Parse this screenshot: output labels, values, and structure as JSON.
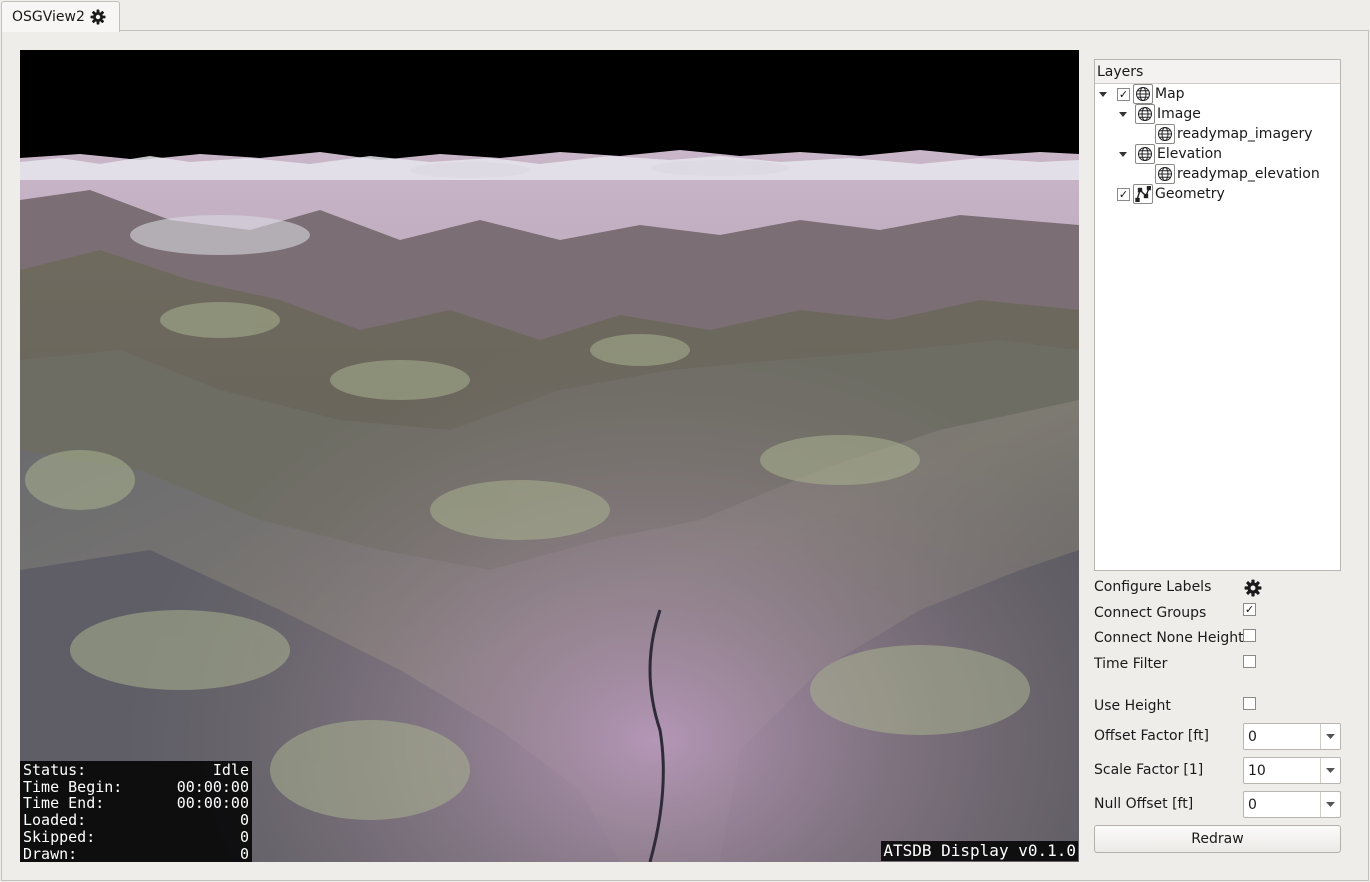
{
  "tab": {
    "title": "OSGView2",
    "icon": "gear-icon"
  },
  "viewport": {
    "status": [
      {
        "label": "Status:",
        "value": "Idle"
      },
      {
        "label": "Time Begin:",
        "value": "00:00:00"
      },
      {
        "label": "Time End:",
        "value": "00:00:00"
      },
      {
        "label": "Loaded:",
        "value": "0"
      },
      {
        "label": "Skipped:",
        "value": "0"
      },
      {
        "label": "Drawn:",
        "value": "0"
      }
    ],
    "version": "ATSDB Display v0.1.0"
  },
  "layers": {
    "header": "Layers",
    "items": [
      {
        "label": "Map",
        "checked": true,
        "expanded": true,
        "icon": "globe-icon"
      },
      {
        "label": "Image",
        "expanded": true,
        "icon": "globe-icon"
      },
      {
        "label": "readymap_imagery",
        "icon": "globe-icon"
      },
      {
        "label": "Elevation",
        "expanded": true,
        "icon": "globe-icon"
      },
      {
        "label": "readymap_elevation",
        "icon": "globe-icon"
      },
      {
        "label": "Geometry",
        "checked": true,
        "icon": "geometry-icon"
      }
    ]
  },
  "controls": {
    "configure_labels": "Configure Labels",
    "connect_groups": {
      "label": "Connect Groups",
      "checked": true
    },
    "connect_none_height": {
      "label": "Connect None Height",
      "checked": false
    },
    "time_filter": {
      "label": "Time Filter",
      "checked": false
    },
    "use_height": {
      "label": "Use Height",
      "checked": false
    },
    "offset_factor": {
      "label": "Offset Factor [ft]",
      "value": "0"
    },
    "scale_factor": {
      "label": "Scale Factor [1]",
      "value": "10"
    },
    "null_offset": {
      "label": "Null Offset [ft]",
      "value": "0"
    },
    "redraw": "Redraw"
  }
}
